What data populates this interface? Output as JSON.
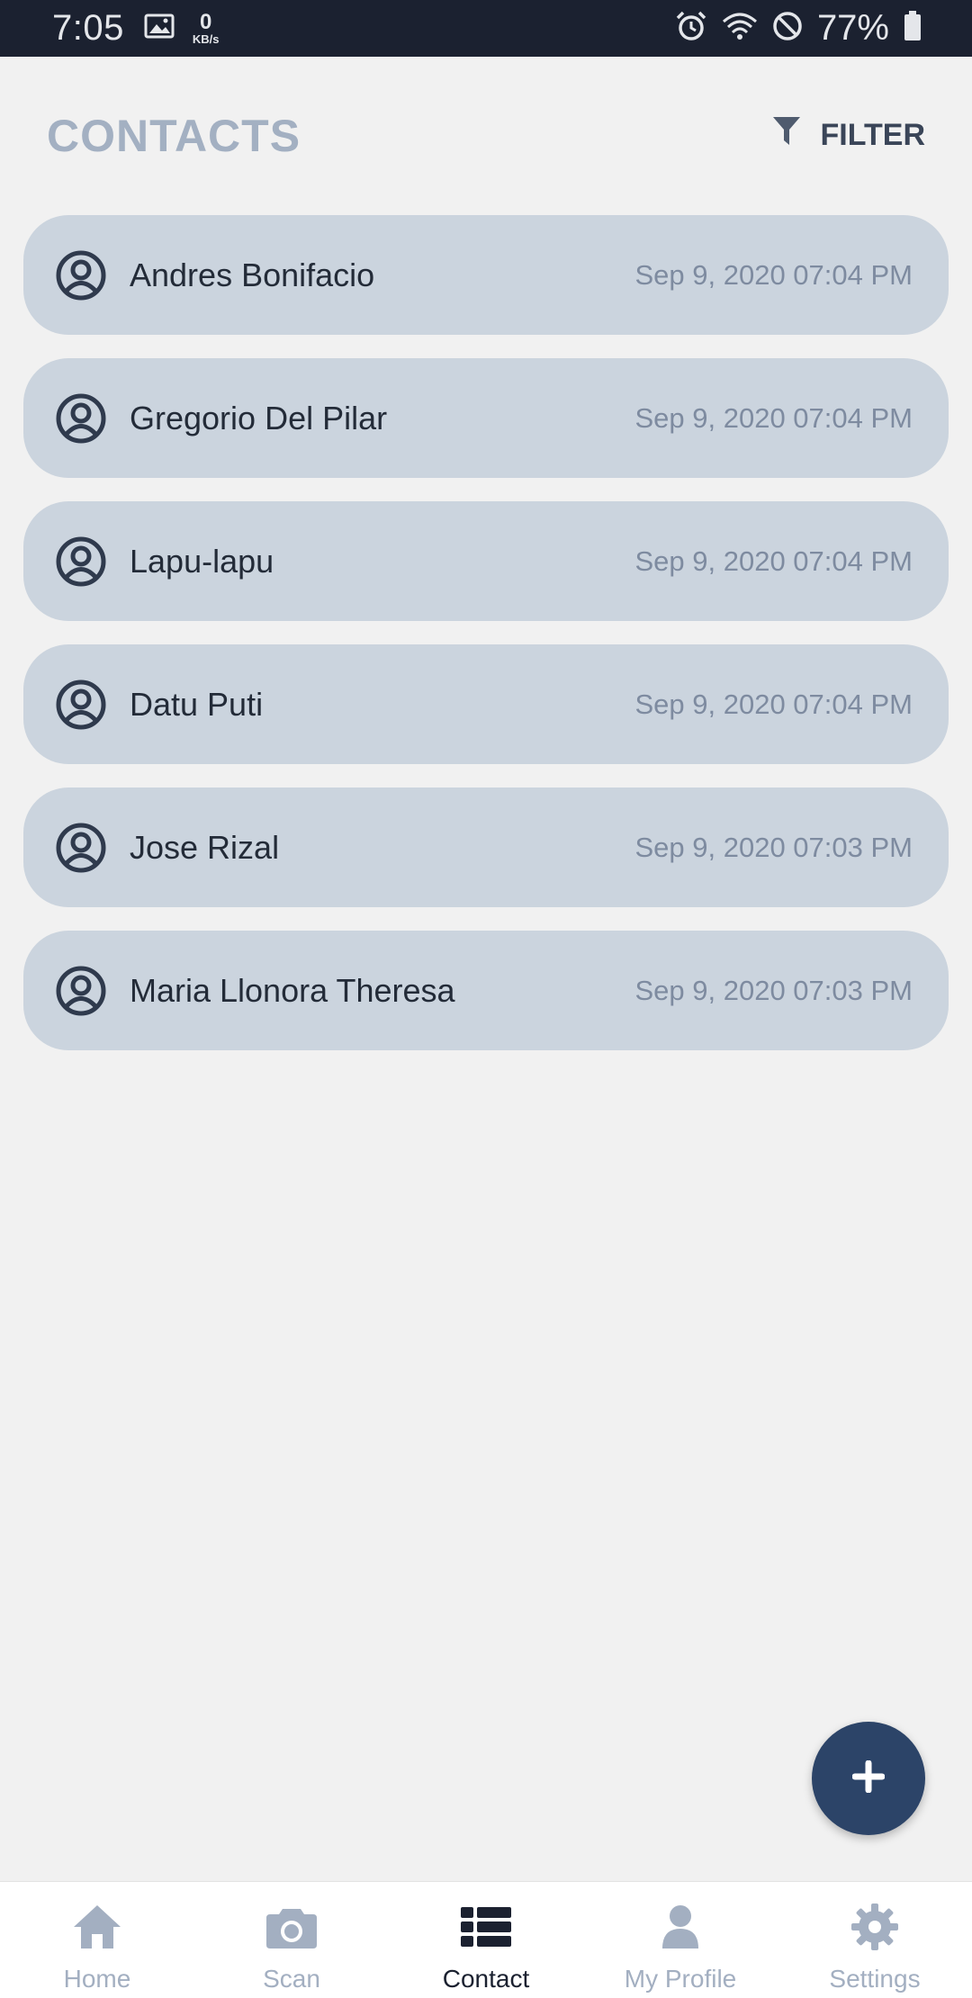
{
  "status_bar": {
    "time": "7:05",
    "net_speed_value": "0",
    "net_speed_unit": "KB/s",
    "battery_percent": "77%",
    "icons": [
      "image-icon",
      "alarm-icon",
      "wifi-icon",
      "do-not-disturb-icon",
      "battery-icon"
    ]
  },
  "header": {
    "title": "CONTACTS",
    "filter_label": "FILTER"
  },
  "contacts": [
    {
      "name": "Andres Bonifacio",
      "time": "Sep 9, 2020 07:04 PM"
    },
    {
      "name": "Gregorio Del Pilar",
      "time": "Sep 9, 2020 07:04 PM"
    },
    {
      "name": "Lapu-lapu",
      "time": "Sep 9, 2020 07:04 PM"
    },
    {
      "name": "Datu Puti",
      "time": "Sep 9, 2020 07:04 PM"
    },
    {
      "name": "Jose Rizal",
      "time": "Sep 9, 2020 07:03 PM"
    },
    {
      "name": "Maria Llonora Theresa",
      "time": "Sep 9, 2020 07:03 PM"
    }
  ],
  "fab": {
    "icon": "plus-icon"
  },
  "nav": {
    "items": [
      {
        "label": "Home",
        "icon": "home-icon"
      },
      {
        "label": "Scan",
        "icon": "camera-icon"
      },
      {
        "label": "Contact",
        "icon": "list-icon"
      },
      {
        "label": "My Profile",
        "icon": "person-icon"
      },
      {
        "label": "Settings",
        "icon": "gear-icon"
      }
    ],
    "active": "Contact"
  },
  "colors": {
    "status_bar_bg": "#1b2130",
    "card_bg": "#cbd4de",
    "title": "#a3b0c2",
    "fab_bg": "#2c4468",
    "nav_inactive": "#a3afc1",
    "nav_active": "#1b2130"
  }
}
